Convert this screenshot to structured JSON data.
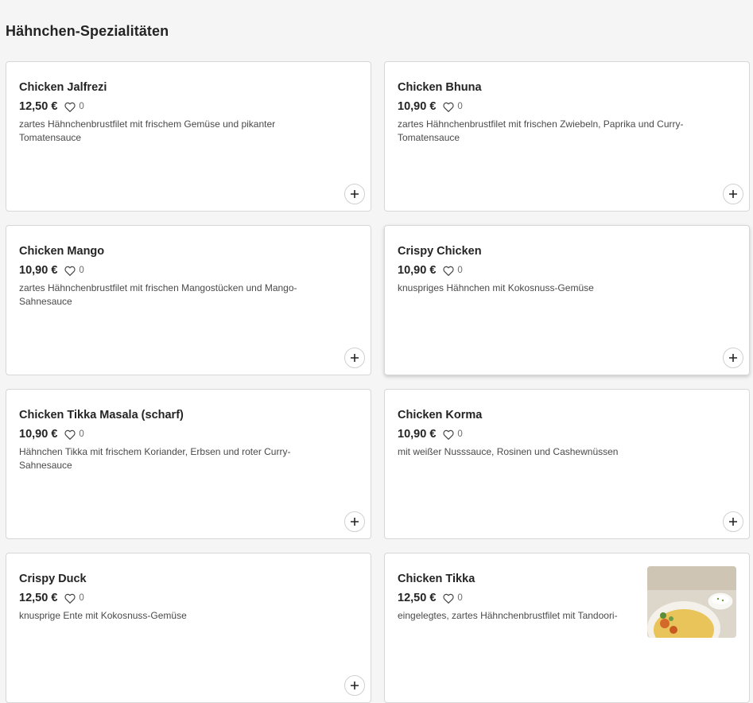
{
  "section": {
    "title": "Hähnchen-Spezialitäten"
  },
  "colors": {
    "accent": "#242424",
    "card_bg": "#ffffff",
    "page_bg": "#f5f5f5"
  },
  "items": [
    {
      "name": "Chicken Jalfrezi",
      "price": "12,50 €",
      "likes": "0",
      "desc": "zartes Hähnchenbrustfilet mit frischem Gemüse und pikanter Tomatensauce"
    },
    {
      "name": "Chicken Bhuna",
      "price": "10,90 €",
      "likes": "0",
      "desc": "zartes Hähnchenbrustfilet mit frischen Zwiebeln, Paprika und Curry-Tomatensauce"
    },
    {
      "name": "Chicken Mango",
      "price": "10,90 €",
      "likes": "0",
      "desc": "zartes Hähnchenbrustfilet mit frischen Mangostücken und Mango-Sahnesauce"
    },
    {
      "name": "Crispy Chicken",
      "price": "10,90 €",
      "likes": "0",
      "desc": "knuspriges Hähnchen mit Kokosnuss-Gemüse"
    },
    {
      "name": "Chicken Tikka Masala (scharf)",
      "price": "10,90 €",
      "likes": "0",
      "desc": "Hähnchen Tikka mit frischem Koriander, Erbsen und roter Curry-Sahnesauce"
    },
    {
      "name": "Chicken Korma",
      "price": "10,90 €",
      "likes": "0",
      "desc": "mit weißer Nusssauce, Rosinen und Cashewnüssen"
    },
    {
      "name": "Crispy Duck",
      "price": "12,50 €",
      "likes": "0",
      "desc": "knusprige Ente mit Kokosnuss-Gemüse"
    },
    {
      "name": "Chicken Tikka",
      "price": "12,50 €",
      "likes": "0",
      "desc": "eingelegtes, zartes Hähnchenbrustfilet mit Tandoori-"
    }
  ]
}
